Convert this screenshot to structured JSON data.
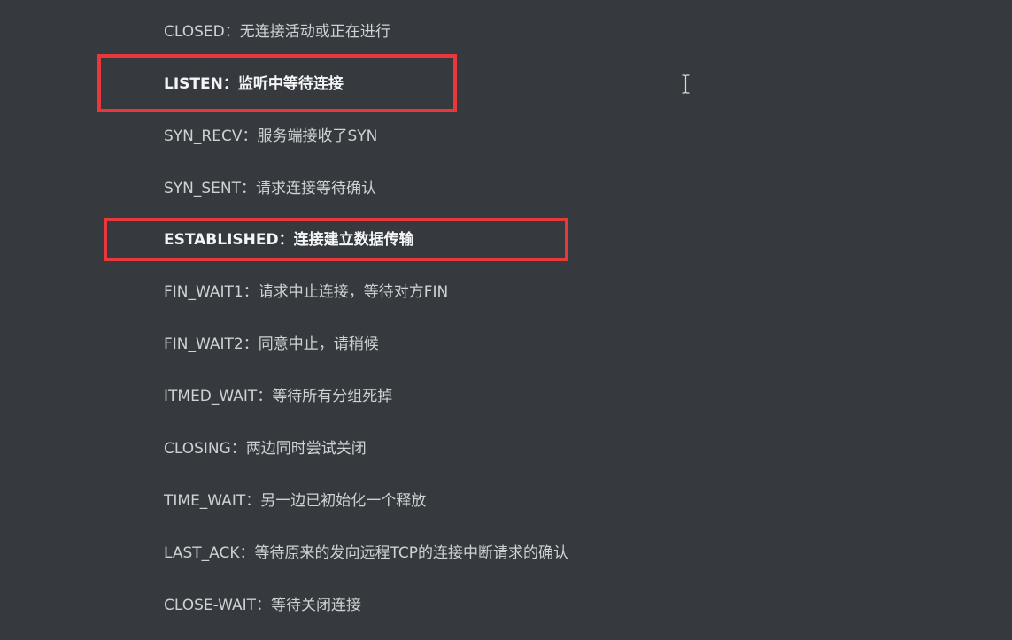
{
  "states": [
    {
      "name": "CLOSED",
      "sep": "：",
      "desc": "无连接活动或正在进行",
      "highlighted": false
    },
    {
      "name": "LISTEN",
      "sep": "：",
      "desc": "监听中等待连接",
      "highlighted": true
    },
    {
      "name": "SYN_RECV",
      "sep": "：",
      "desc": "服务端接收了SYN",
      "highlighted": false
    },
    {
      "name": "SYN_SENT",
      "sep": "：",
      "desc": "请求连接等待确认",
      "highlighted": false
    },
    {
      "name": "ESTABLISHED",
      "sep": "：",
      "desc": "连接建立数据传输",
      "highlighted": true
    },
    {
      "name": "FIN_WAIT1",
      "sep": "：",
      "desc": "请求中止连接，等待对方FIN",
      "highlighted": false
    },
    {
      "name": "FIN_WAIT2",
      "sep": "：",
      "desc": "同意中止，请稍候",
      "highlighted": false
    },
    {
      "name": "ITMED_WAIT",
      "sep": "：",
      "desc": "等待所有分组死掉",
      "highlighted": false
    },
    {
      "name": "CLOSING",
      "sep": "：",
      "desc": "两边同时尝试关闭",
      "highlighted": false
    },
    {
      "name": "TIME_WAIT",
      "sep": "：",
      "desc": "另一边已初始化一个释放",
      "highlighted": false
    },
    {
      "name": "LAST_ACK",
      "sep": "：",
      "desc": "等待原来的发向远程TCP的连接中断请求的确认",
      "highlighted": false
    },
    {
      "name": "CLOSE-WAIT",
      "sep": "：",
      "desc": "等待关闭连接",
      "highlighted": false
    }
  ],
  "colors": {
    "background": "#36393d",
    "text": "#cfd2d4",
    "highlight_text": "#f4f5f6",
    "highlight_border": "#e8383b"
  }
}
